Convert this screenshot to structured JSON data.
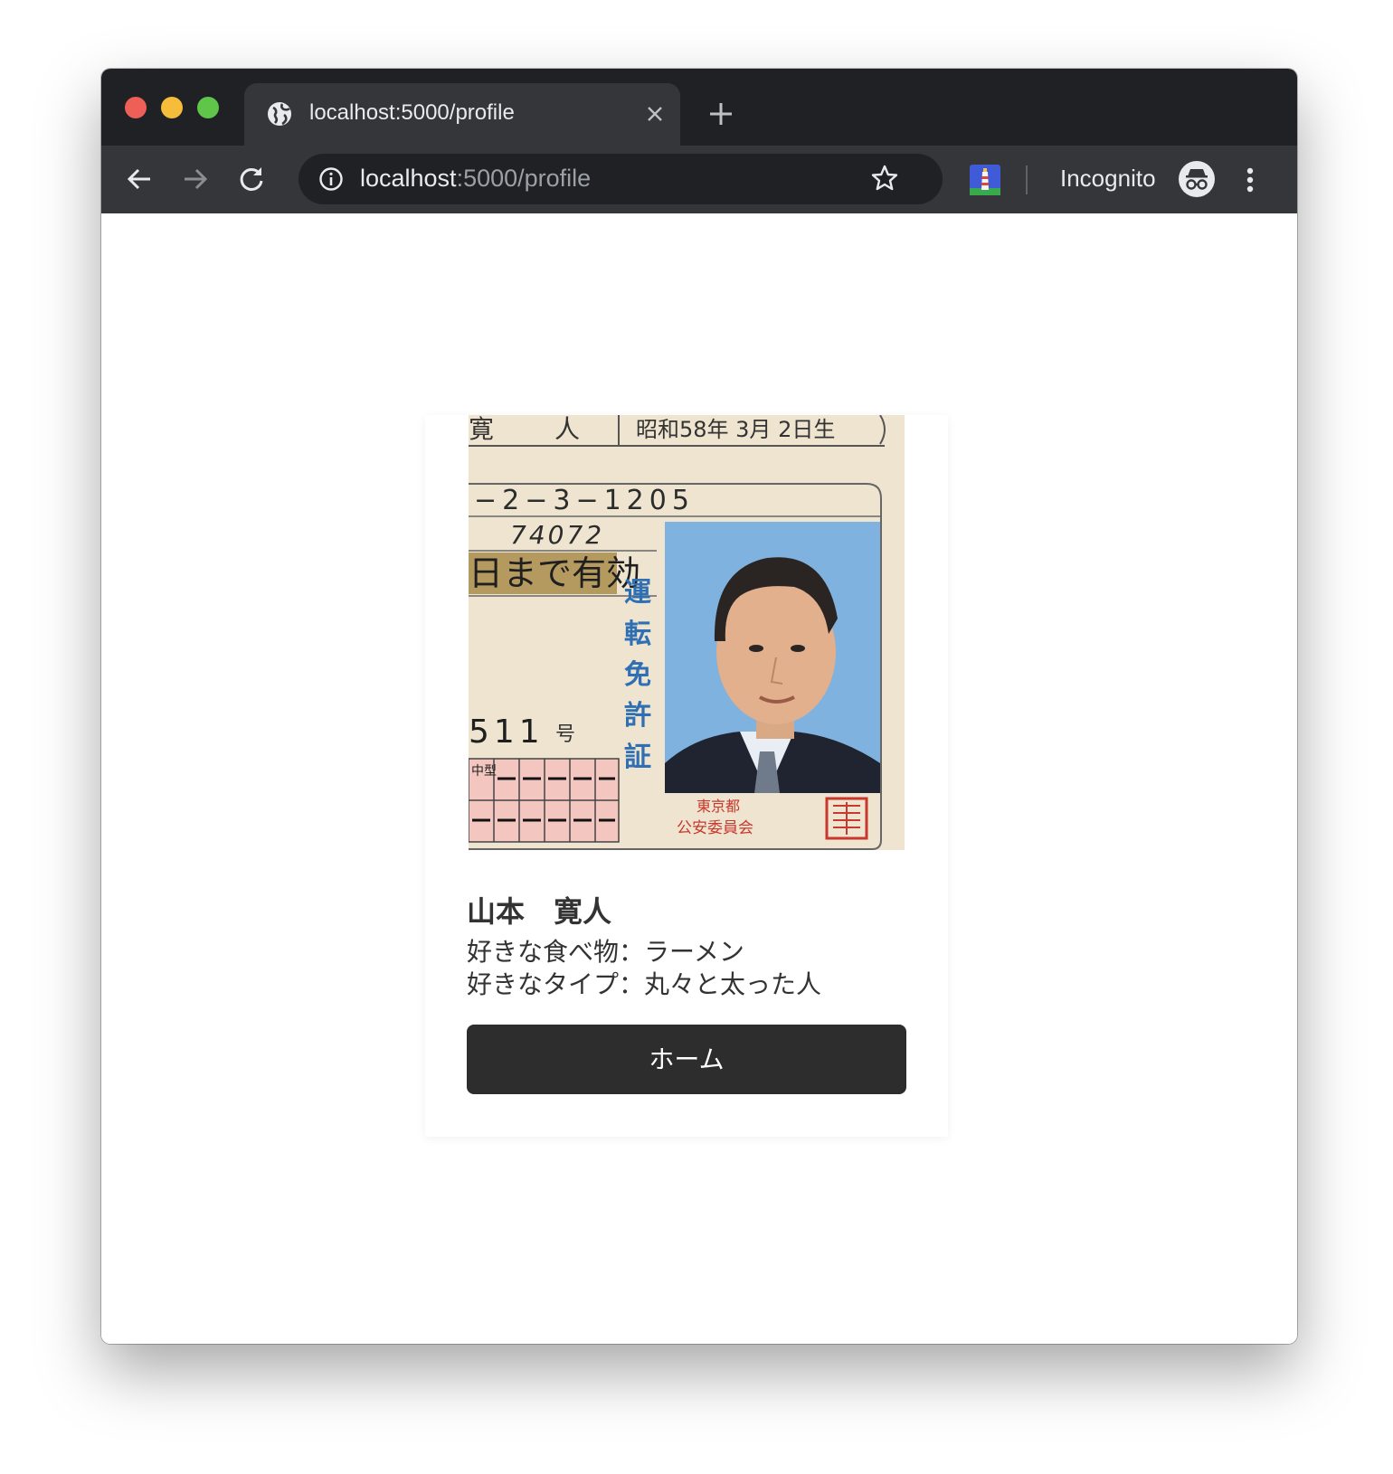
{
  "browser": {
    "tab_title": "localhost:5000/profile",
    "url_host": "localhost",
    "url_rest": ":5000/profile",
    "profile_label": "Incognito"
  },
  "profile": {
    "name": "山本　寛人",
    "favorite_food": "好きな食べ物：ラーメン",
    "favorite_type": "好きなタイプ：丸々と太った人",
    "home_button": "ホーム"
  },
  "license_photo": {
    "birth_text": "昭和58年 3月 2日生",
    "name_fragment_1": "寛",
    "name_fragment_2": "人",
    "address_fragment": "−2−3−1205",
    "number_fragment": "74072",
    "valid_text": "日まで有効",
    "license_number_fragment": "511",
    "number_suffix": "号",
    "vertical_title": [
      "運",
      "転",
      "免",
      "許",
      "証"
    ],
    "issuer_line_1": "東京都",
    "issuer_line_2": "公安委員会",
    "class_label": "中型",
    "colors": {
      "card_bg": "#f1e8d8",
      "photo_bg": "#7fb2df",
      "blue_text": "#2f6fb3",
      "red_seal": "#c8382c",
      "highlight": "#b59a60"
    }
  },
  "colors": {
    "chrome_dark": "#202124",
    "chrome_toolbar": "#35363a",
    "button_bg": "#2d2d2d"
  }
}
